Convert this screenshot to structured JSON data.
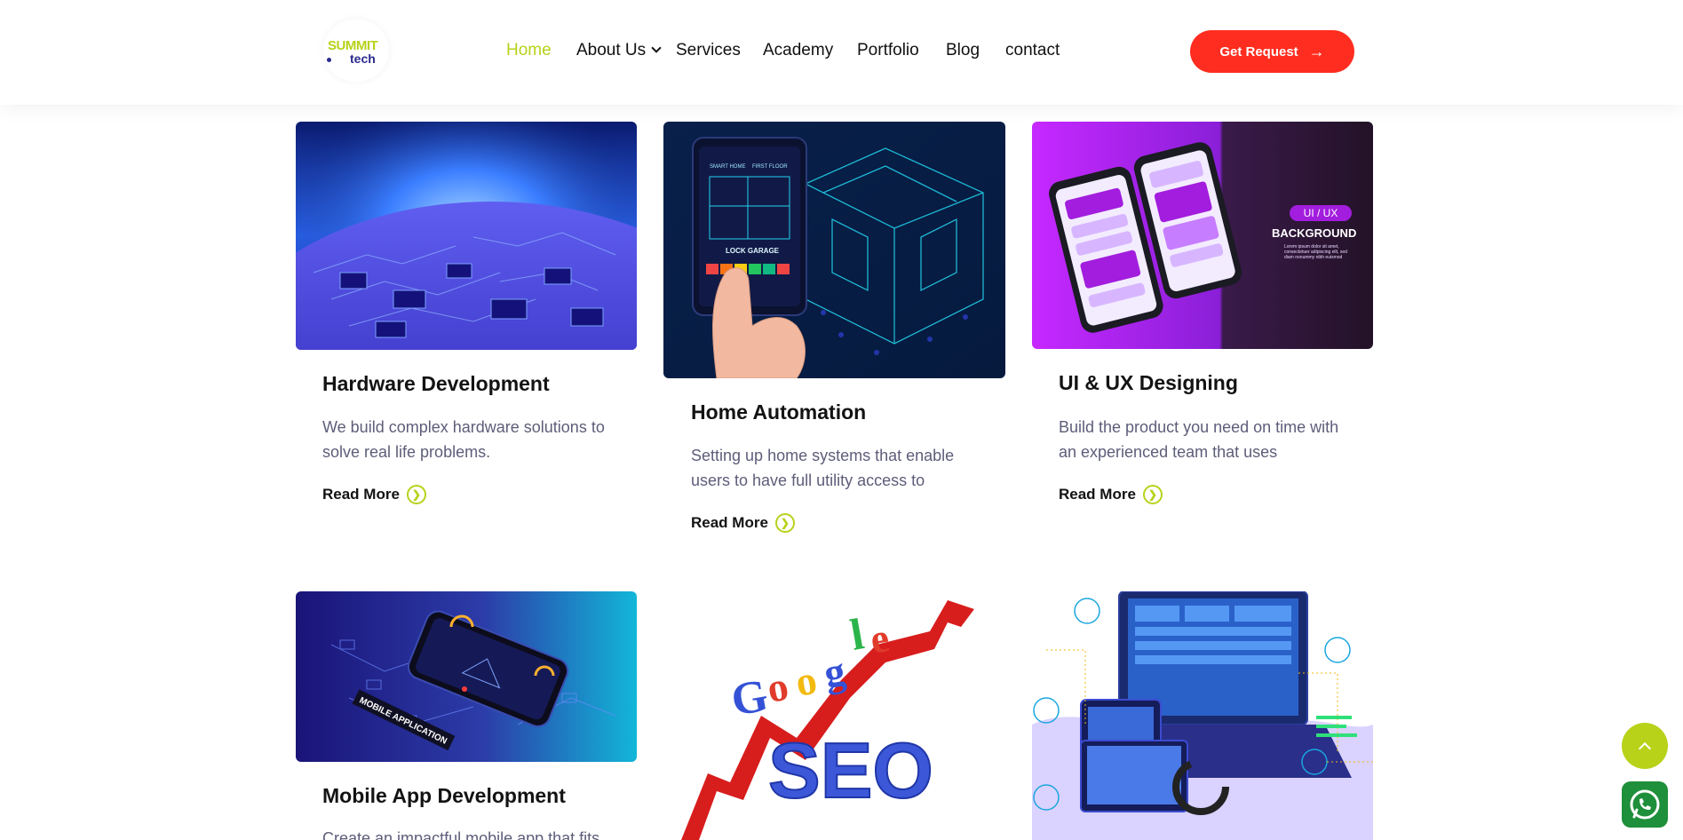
{
  "header": {
    "logo": {
      "line1": "SUMMIT",
      "line2": "tech"
    },
    "nav": [
      {
        "label": "Home",
        "active": true
      },
      {
        "label": "About Us",
        "has_dropdown": true
      },
      {
        "label": "Services"
      },
      {
        "label": "Academy"
      },
      {
        "label": "Portfolio"
      },
      {
        "label": "Blog"
      },
      {
        "label": "contact"
      }
    ],
    "cta_label": "Get Request"
  },
  "cards": [
    {
      "title": "Hardware Development",
      "description": "We build complex hardware solutions to solve real life problems.",
      "read_more": "Read More"
    },
    {
      "title": "Home Automation",
      "description": "Setting up home systems that enable users to have full utility access to",
      "read_more": "Read More"
    },
    {
      "title": "UI & UX Designing",
      "description": "Build the product you need on time with an experienced team that uses",
      "read_more": "Read More"
    },
    {
      "title": "Mobile App Development",
      "description": "Create an impactful mobile app that fits"
    }
  ],
  "images": {
    "home_phone": {
      "line1": "SMART HOME",
      "line2": "FIRST FLOOR",
      "lock": "LOCK GARAGE"
    },
    "uiux": {
      "badge": "UI / UX",
      "heading": "BACKGROUND",
      "body": "Lorem ipsum dolor sit amet, consectetuer adipiscing elit, sed diam nonummy nibh euismod"
    },
    "mobile": {
      "label": "MOBILE APPLICATION"
    },
    "seo": {
      "google": [
        "G",
        "o",
        "o",
        "g",
        "l",
        "e"
      ],
      "seo": "SEO"
    }
  },
  "colors": {
    "accent": "#b8d21a",
    "cta": "#ff2d1f",
    "desc_text": "#5d5d7a",
    "whatsapp": "#1e8f3a"
  }
}
